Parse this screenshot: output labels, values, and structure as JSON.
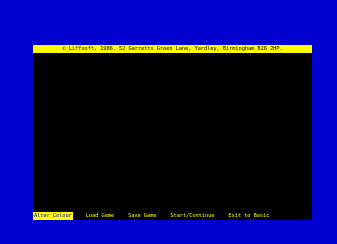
{
  "header": {
    "copyright": "© Liffsoft, 1986.  52 Garretts Green Lane, Yardley, Birmingham B26 2HP."
  },
  "menu": {
    "items": [
      {
        "label": "Alter Colour",
        "selected": true
      },
      {
        "label": "Load Game",
        "selected": false
      },
      {
        "label": "Save Game",
        "selected": false
      },
      {
        "label": "Start/Continue",
        "selected": false
      },
      {
        "label": "Exit to Basic",
        "selected": false
      }
    ]
  },
  "colors": {
    "border": "#0000cf",
    "paper": "#000000",
    "highlight": "#ffff00"
  }
}
